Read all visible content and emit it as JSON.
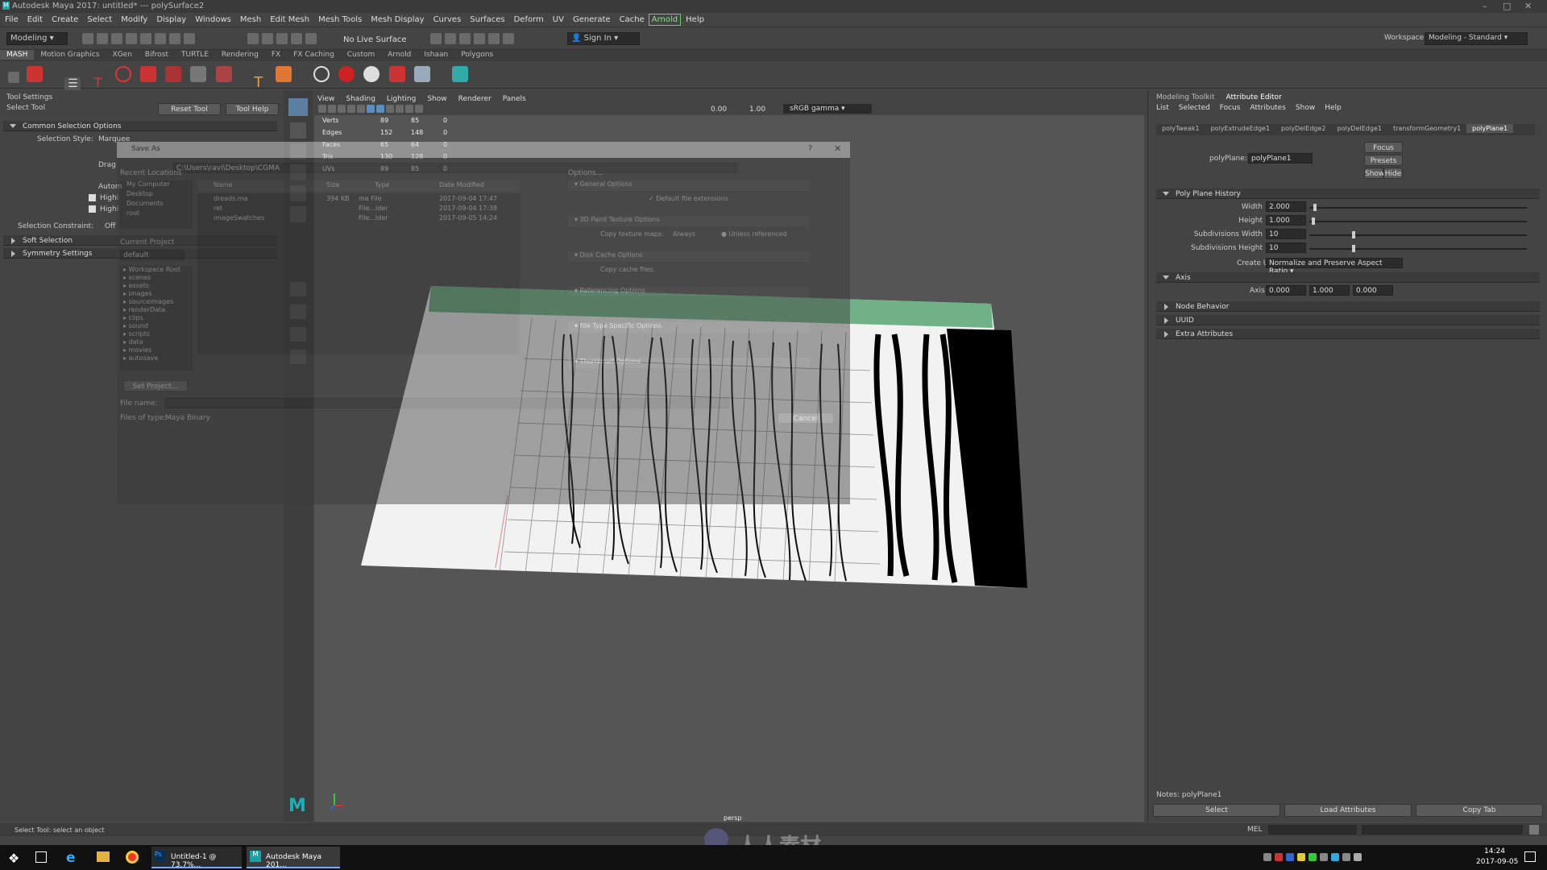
{
  "window": {
    "title": "Autodesk Maya 2017: untitled*   ---   polySurface2",
    "watermark_url": "www.rr-sc.com"
  },
  "menu": [
    "File",
    "Edit",
    "Create",
    "Select",
    "Modify",
    "Display",
    "Windows",
    "Mesh",
    "Edit Mesh",
    "Mesh Tools",
    "Mesh Display",
    "Curves",
    "Surfaces",
    "Deform",
    "UV",
    "Generate",
    "Cache",
    "Arnold",
    "Help"
  ],
  "menu_highlight": "Arnold",
  "status_line": {
    "mode": "Modeling",
    "live_surface": "No Live Surface",
    "sign_in": "Sign In",
    "workspace_label": "Workspace :",
    "workspace_value": "Modeling - Standard"
  },
  "shelf_tabs": [
    "MASH",
    "Motion Graphics",
    "XGen",
    "Bifrost",
    "TURTLE",
    "Rendering",
    "FX",
    "FX Caching",
    "Custom",
    "Arnold",
    "Ishaan",
    "Polygons"
  ],
  "tool_settings": {
    "header": "Tool Settings",
    "tool_name": "Select Tool",
    "reset_label": "Reset Tool",
    "help_label": "Tool Help",
    "section_common": "Common Selection Options",
    "selection_style_label": "Selection Style:",
    "selection_style_value": "Marquee",
    "drag_label": "Drag",
    "auto_label": "Autom",
    "highlight1": "Highl",
    "highlight2": "Highl",
    "constraint_label": "Selection Constraint:",
    "constraint_value": "Off",
    "soft_selection": "Soft Selection",
    "symmetry_settings": "Symmetry Settings"
  },
  "viewport": {
    "menus": [
      "View",
      "Shading",
      "Lighting",
      "Show",
      "Renderer",
      "Panels"
    ],
    "exposure": "0.00",
    "gamma": "1.00",
    "color_space": "sRGB gamma",
    "hud": [
      {
        "label": "Verts",
        "a": "89",
        "b": "85",
        "c": "0"
      },
      {
        "label": "Edges",
        "a": "152",
        "b": "148",
        "c": "0"
      },
      {
        "label": "Faces",
        "a": "65",
        "b": "64",
        "c": "0"
      },
      {
        "label": "Tris",
        "a": "130",
        "b": "128",
        "c": "0"
      },
      {
        "label": "UVs",
        "a": "89",
        "b": "85",
        "c": "0"
      }
    ],
    "camera_label": "persp"
  },
  "save_dialog": {
    "title": "Save As",
    "path": "C:\\Users\\ravi\\Desktop\\CGMA",
    "sidebar_top": [
      "My Computer",
      "Desktop",
      "Documents",
      "root"
    ],
    "recent_label": "Recent Locations",
    "columns": [
      "Name",
      "Size",
      "Type",
      "Date Modified"
    ],
    "files": [
      {
        "name": "dreads.ma",
        "size": "394 KB",
        "type": "ma File",
        "date": "2017-09-04 17:47"
      },
      {
        "name": "ret",
        "size": "",
        "type": "File...lder",
        "date": "2017-09-04 17:38"
      },
      {
        "name": "imageSwatches",
        "size": "",
        "type": "File...lder",
        "date": "2017-09-05 14:24"
      }
    ],
    "current_project_label": "Current Project",
    "project_value": "default",
    "project_folders": [
      "Workspace Root",
      "scenes",
      "assets",
      "images",
      "sourceimages",
      "renderData",
      "clips",
      "sound",
      "scripts",
      "data",
      "movies",
      "autosave"
    ],
    "set_project": "Set Project...",
    "file_name_label": "File name:",
    "file_type_label": "Files of type:",
    "file_type_value": "Maya Binary",
    "options_label": "Options...",
    "option_sections": [
      "General Options",
      "3D Paint Texture Options",
      "Disk Cache Options",
      "Referencing Options",
      "File Type Specific Options",
      "Thumbnail Options"
    ],
    "default_ext": "Default file extensions",
    "copy_texture": "Copy texture maps:",
    "copy_always": "Always",
    "copy_unless": "Unless referenced",
    "copy_cache": "Copy cache files:",
    "cancel": "Cancel"
  },
  "attribute_editor": {
    "tabs": [
      "Modeling Toolkit",
      "Attribute Editor"
    ],
    "menus": [
      "List",
      "Selected",
      "Focus",
      "Attributes",
      "Show",
      "Help"
    ],
    "node_tabs": [
      "polyTweak1",
      "polyExtrudeEdge1",
      "polyDelEdge2",
      "polyDelEdge1",
      "transformGeometry1",
      "polyPlane1"
    ],
    "node_label": "polyPlane:",
    "node_value": "polyPlane1",
    "focus": "Focus",
    "presets": "Presets",
    "show": "Show",
    "hide": "Hide",
    "section_history": "Poly Plane History",
    "attrs": [
      {
        "label": "Width",
        "value": "2.000",
        "level": 0.02
      },
      {
        "label": "Height",
        "value": "1.000",
        "level": 0.01
      },
      {
        "label": "Subdivisions Width",
        "value": "10",
        "level": 0.2
      },
      {
        "label": "Subdivisions Height",
        "value": "10",
        "level": 0.2
      }
    ],
    "create_uvs_label": "Create UVs",
    "create_uvs_value": "Normalize and Preserve Aspect Ratio",
    "axis_section": "Axis",
    "axis_label": "Axis",
    "axis_values": [
      "0.000",
      "1.000",
      "0.000"
    ],
    "collapsed": [
      "Node Behavior",
      "UUID",
      "Extra Attributes"
    ],
    "notes": "Notes:  polyPlane1",
    "bottom_buttons": [
      "Select",
      "Load Attributes",
      "Copy Tab"
    ]
  },
  "help_line": "Select Tool: select an object",
  "mel_label": "MEL",
  "taskbar": {
    "items": [
      "Untitled-1 @ 73.7%...",
      "Autodesk Maya 201..."
    ],
    "time": "14:24",
    "date": "2017-09-05"
  },
  "bottom_watermark": "人人素材",
  "colors": {
    "accent_green": "#8fe08f",
    "ui_bg": "#444444",
    "viewport_bg": "#555555"
  }
}
